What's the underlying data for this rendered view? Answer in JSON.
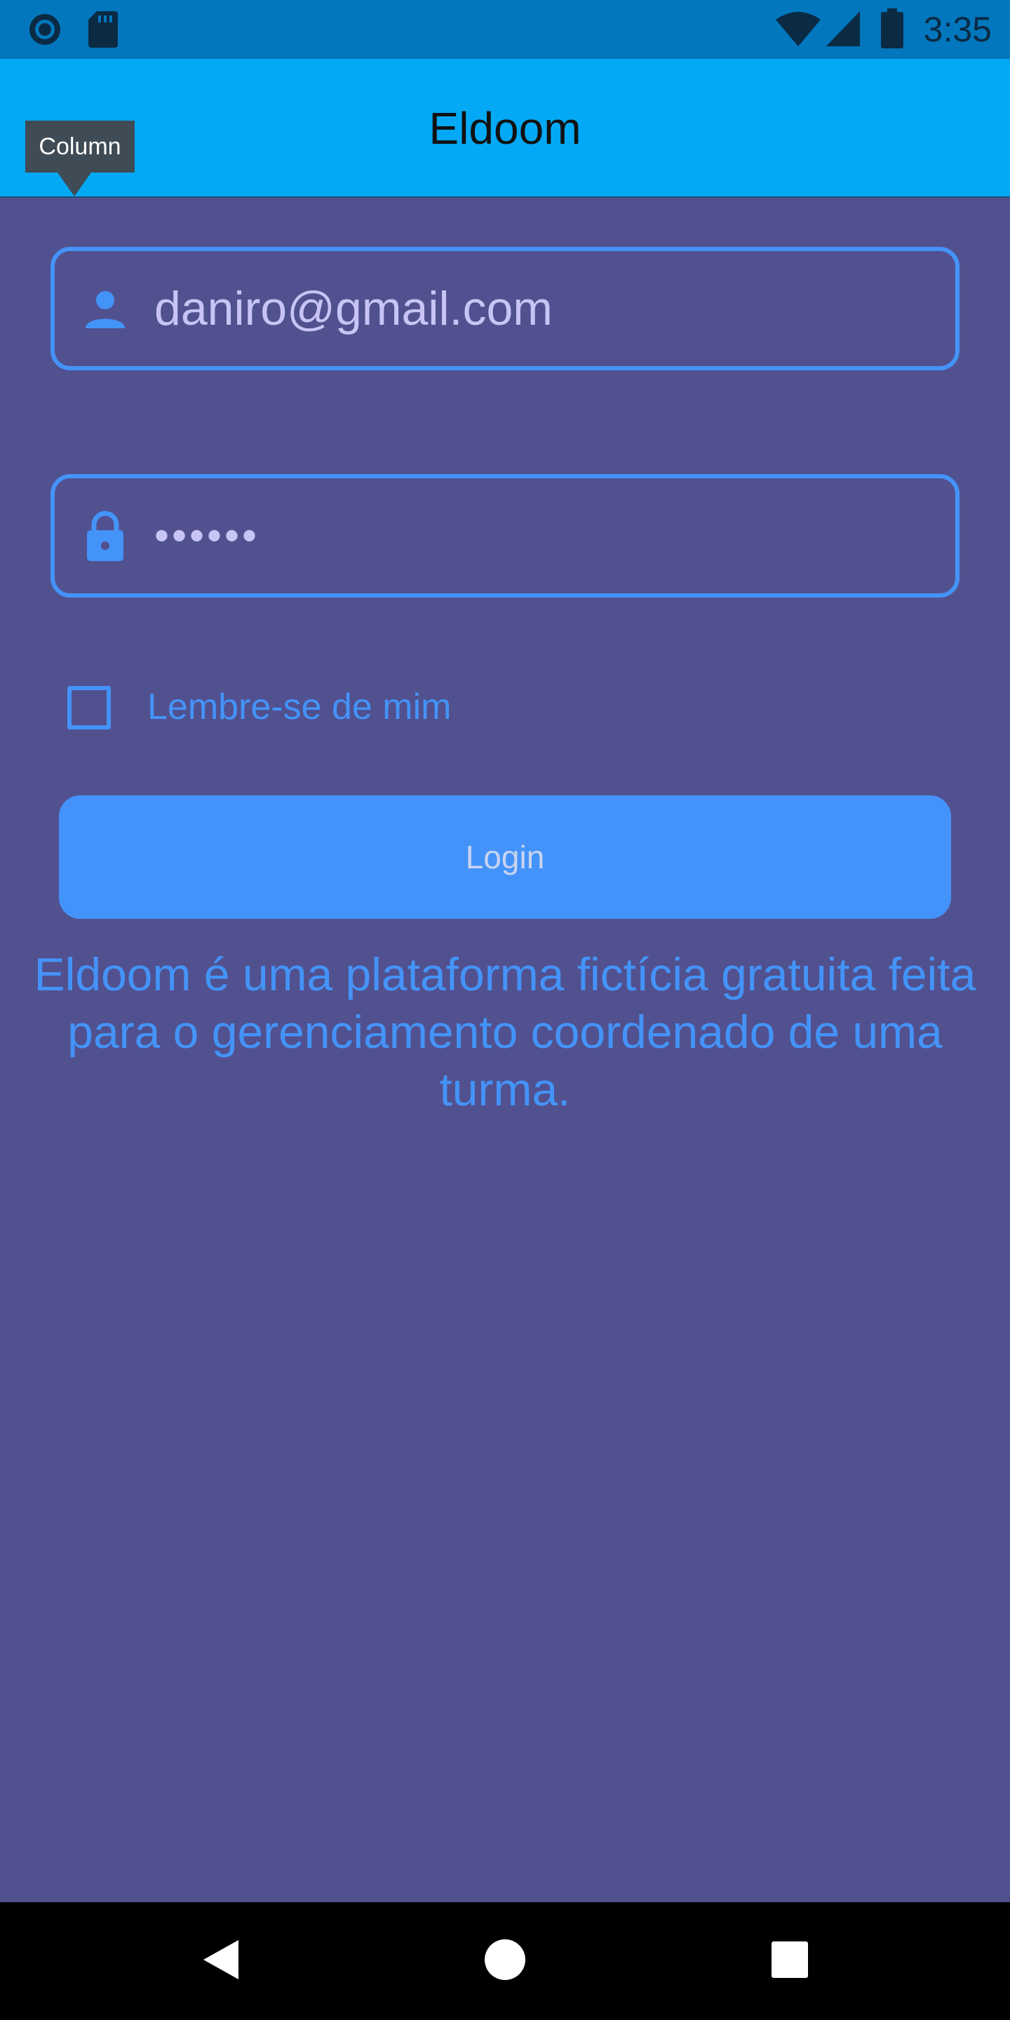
{
  "status_bar": {
    "time": "3:35",
    "icons": [
      "circle-notification-icon",
      "sd-card-icon",
      "wifi-icon",
      "cell-signal-icon",
      "battery-icon"
    ]
  },
  "app_bar": {
    "title": "Eldoom"
  },
  "tooltip": {
    "text": "Column"
  },
  "login_form": {
    "email": {
      "icon": "person-icon",
      "value": "daniro@gmail.com"
    },
    "password": {
      "icon": "lock-icon",
      "value": "••••••"
    },
    "remember_me": {
      "label": "Lembre-se de mim",
      "checked": false
    },
    "login_button_label": "Login"
  },
  "description": "Eldoom é uma plataforma fictícia gratuita feita para o gerenciamento coordenado de uma turma.",
  "nav_bar": {
    "icons": [
      "back-icon",
      "home-icon",
      "recents-icon"
    ]
  },
  "colors": {
    "status_bar": "#0277bd",
    "app_bar": "#03a9f4",
    "background": "#51518f",
    "accent": "#4493f8",
    "input_text": "#c8c4f5",
    "tooltip": "#3f4b55"
  }
}
